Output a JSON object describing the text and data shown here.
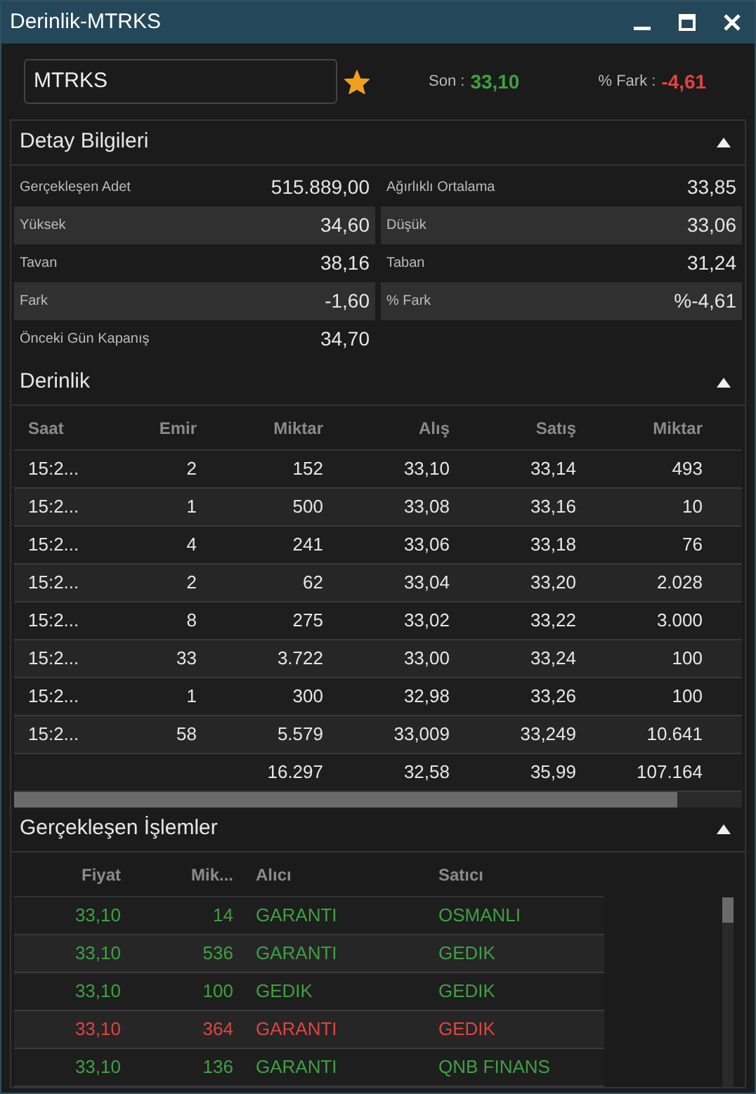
{
  "window": {
    "title": "Derinlik-MTRKS"
  },
  "symbol": {
    "value": "MTRKS",
    "favorite": true
  },
  "son": {
    "label": "Son :",
    "value": "33,10"
  },
  "fark": {
    "label": "% Fark :",
    "value": "-4,61"
  },
  "detail": {
    "title": "Detay Bilgileri",
    "expanded": true,
    "rows": [
      [
        {
          "label": "Gerçekleşen Adet",
          "value": "515.889,00"
        },
        {
          "label": "Ağırlıklı Ortalama",
          "value": "33,85"
        }
      ],
      [
        {
          "label": "Yüksek",
          "value": "34,60"
        },
        {
          "label": "Düşük",
          "value": "33,06"
        }
      ],
      [
        {
          "label": "Tavan",
          "value": "38,16"
        },
        {
          "label": "Taban",
          "value": "31,24"
        }
      ],
      [
        {
          "label": "Fark",
          "value": "-1,60"
        },
        {
          "label": "% Fark",
          "value": "%-4,61"
        }
      ],
      [
        {
          "label": "Önceki Gün Kapanış",
          "value": "34,70"
        }
      ]
    ]
  },
  "depth": {
    "title": "Derinlik",
    "expanded": true,
    "columns": [
      "Saat",
      "Emir",
      "Miktar",
      "Alış",
      "Satış",
      "Miktar"
    ],
    "rows": [
      [
        "15:2...",
        "2",
        "152",
        "33,10",
        "33,14",
        "493"
      ],
      [
        "15:2...",
        "1",
        "500",
        "33,08",
        "33,16",
        "10"
      ],
      [
        "15:2...",
        "4",
        "241",
        "33,06",
        "33,18",
        "76"
      ],
      [
        "15:2...",
        "2",
        "62",
        "33,04",
        "33,20",
        "2.028"
      ],
      [
        "15:2...",
        "8",
        "275",
        "33,02",
        "33,22",
        "3.000"
      ],
      [
        "15:2...",
        "33",
        "3.722",
        "33,00",
        "33,24",
        "100"
      ],
      [
        "15:2...",
        "1",
        "300",
        "32,98",
        "33,26",
        "100"
      ],
      [
        "15:2...",
        "58",
        "5.579",
        "33,009",
        "33,249",
        "10.641"
      ]
    ],
    "totals": [
      "16.297",
      "32,58",
      "35,99",
      "107.164"
    ]
  },
  "trades": {
    "title": "Gerçekleşen İşlemler",
    "expanded": true,
    "columns": [
      "Fiyat",
      "Mik...",
      "Alıcı",
      "Satıcı"
    ],
    "rows": [
      {
        "kind": "up",
        "cells": [
          "33,10",
          "14",
          "GARANTI",
          "OSMANLI"
        ]
      },
      {
        "kind": "up",
        "cells": [
          "33,10",
          "536",
          "GARANTI",
          "GEDIK"
        ]
      },
      {
        "kind": "up",
        "cells": [
          "33,10",
          "100",
          "GEDIK",
          "GEDIK"
        ]
      },
      {
        "kind": "down",
        "cells": [
          "33,10",
          "364",
          "GARANTI",
          "GEDIK"
        ]
      },
      {
        "kind": "up",
        "cells": [
          "33,10",
          "136",
          "GARANTI",
          "QNB FINANS"
        ]
      }
    ]
  }
}
